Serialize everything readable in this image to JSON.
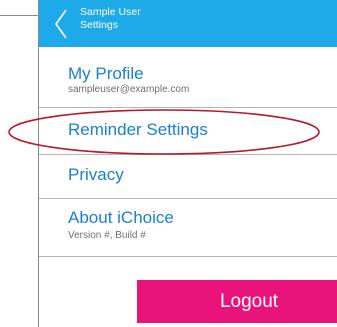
{
  "header": {
    "user_name": "Sample User",
    "title": "Settings",
    "back_icon": "chevron-left-icon"
  },
  "menu": {
    "items": [
      {
        "title": "My Profile",
        "subtitle": "sampleuser@example.com"
      },
      {
        "title": "Reminder Settings",
        "subtitle": ""
      },
      {
        "title": "Privacy",
        "subtitle": ""
      },
      {
        "title": "About iChoice",
        "subtitle": "Version #, Build #"
      }
    ]
  },
  "logout": {
    "label": "Logout"
  },
  "colors": {
    "header_bg": "#1ea9e8",
    "item_title": "#1a7fd3",
    "logout_bg": "#e8147c",
    "annotation_ellipse": "#b5192b"
  }
}
